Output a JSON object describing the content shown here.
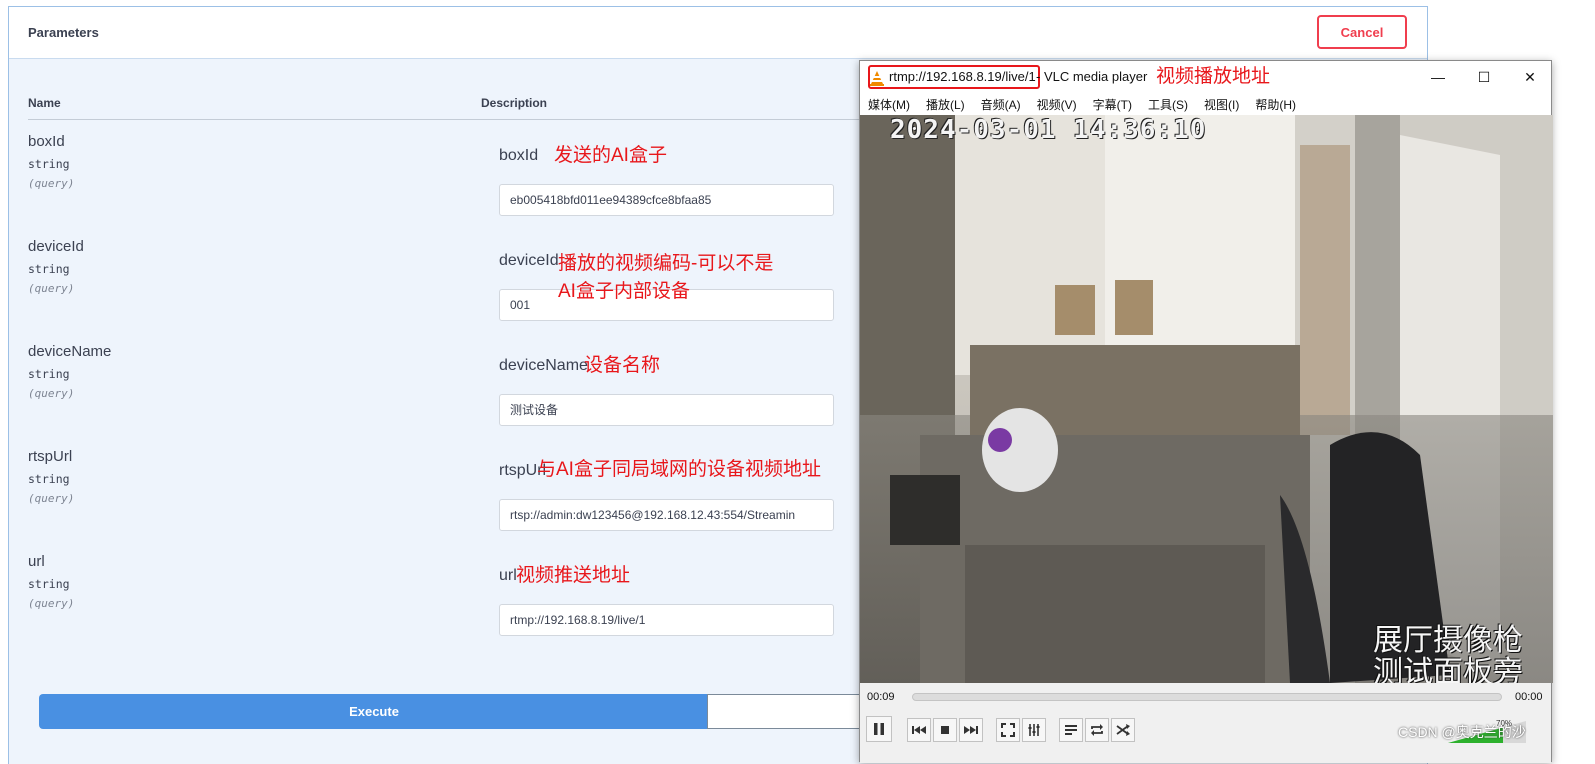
{
  "params": {
    "title": "Parameters",
    "cancel_label": "Cancel",
    "col_name": "Name",
    "col_description": "Description",
    "items": [
      {
        "name": "boxId",
        "type": "string",
        "in": "(query)",
        "desc": "boxId",
        "value": "eb005418bfd011ee94389cfce8bfaa85"
      },
      {
        "name": "deviceId",
        "type": "string",
        "in": "(query)",
        "desc": "deviceId",
        "value": "001"
      },
      {
        "name": "deviceName",
        "type": "string",
        "in": "(query)",
        "desc": "deviceName",
        "value": "测试设备"
      },
      {
        "name": "rtspUrl",
        "type": "string",
        "in": "(query)",
        "desc": "rtspUrl",
        "value": "rtsp://admin:dw123456@192.168.12.43:554/Streamin"
      },
      {
        "name": "url",
        "type": "string",
        "in": "(query)",
        "desc": "url",
        "value": "rtmp://192.168.8.19/live/1"
      }
    ],
    "execute_label": "Execute"
  },
  "annotations": {
    "boxId": "发送的AI盒子",
    "deviceId_1": "播放的视频编码-可以不是",
    "deviceId_2": "AI盒子内部设备",
    "deviceName": "设备名称",
    "rtspUrl": "与AI盒子同局域网的设备视频地址",
    "url": "视频推送地址",
    "vlc_title": "视频播放地址"
  },
  "vlc": {
    "url": "rtmp://192.168.8.19/live/1",
    "title_suffix": "- VLC media player",
    "minimize": "—",
    "maximize": "☐",
    "close": "✕",
    "menu": [
      "媒体(M)",
      "播放(L)",
      "音频(A)",
      "视频(V)",
      "字幕(T)",
      "工具(S)",
      "视图(I)",
      "帮助(H)"
    ],
    "timestamp": "2024-03-01 14:36:10",
    "overlay_line1": "展厅摄像枪",
    "overlay_line2": "测试面板旁",
    "elapsed": "00:09",
    "total": "00:00",
    "volume": "70%"
  },
  "watermark": "CSDN @奥克兰的沙"
}
